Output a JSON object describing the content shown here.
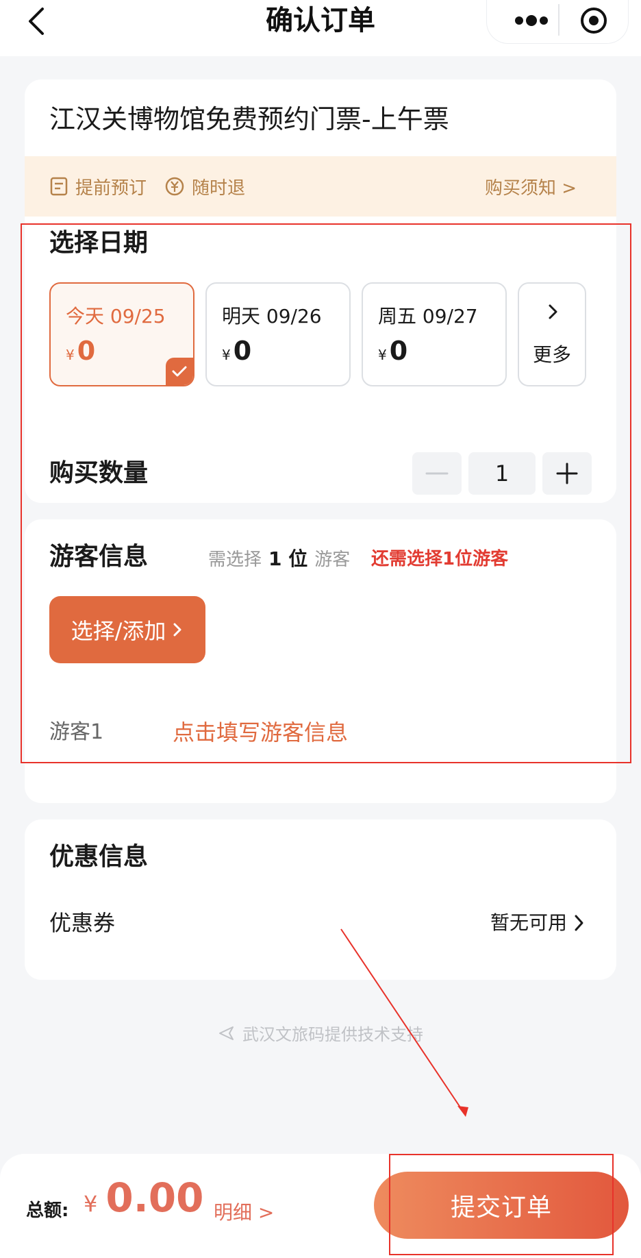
{
  "header": {
    "title": "确认订单"
  },
  "product": {
    "title": "江汉关博物馆免费预约门票-上午票",
    "notices": [
      "提前预订",
      "随时退"
    ],
    "notice_link": "购买须知 >"
  },
  "date_section": {
    "title": "选择日期",
    "currency": "¥",
    "dates": [
      {
        "label": "今天 09/25",
        "price": "0",
        "selected": true
      },
      {
        "label": "明天 09/26",
        "price": "0",
        "selected": false
      },
      {
        "label": "周五 09/27",
        "price": "0",
        "selected": false
      }
    ],
    "more_label": "更多"
  },
  "quantity": {
    "label": "购买数量",
    "value": "1"
  },
  "visitor": {
    "title": "游客信息",
    "need_prefix": "需选择",
    "need_count": "1 位",
    "need_suffix": "游客",
    "warning": "还需选择1位游客",
    "select_button": "选择/添加",
    "visitor_label": "游客1",
    "fill_prompt": "点击填写游客信息"
  },
  "discount": {
    "title": "优惠信息",
    "coupon_label": "优惠券",
    "coupon_value": "暂无可用"
  },
  "footer_credit": "武汉文旅码提供技术支持",
  "bottom_bar": {
    "total_label": "总额:",
    "currency": "¥",
    "total": "0.00",
    "detail_link": "明细 >",
    "submit_label": "提交订单"
  },
  "colors": {
    "accent": "#e06a3f",
    "warning": "#e23c32",
    "notice_bg": "#fdf1e3",
    "notice_text": "#b5824a",
    "annotation": "#e8322a"
  }
}
